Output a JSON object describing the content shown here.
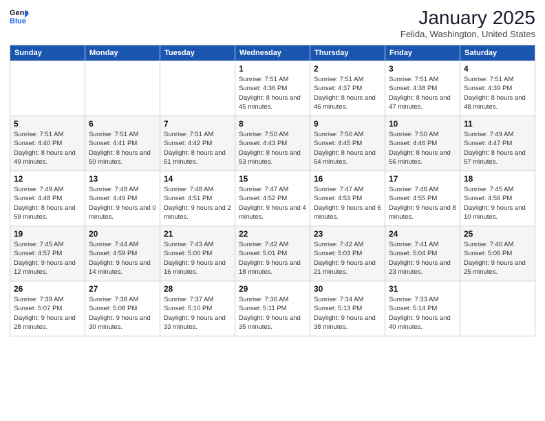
{
  "header": {
    "logo_general": "General",
    "logo_blue": "Blue",
    "month_title": "January 2025",
    "subtitle": "Felida, Washington, United States"
  },
  "weekdays": [
    "Sunday",
    "Monday",
    "Tuesday",
    "Wednesday",
    "Thursday",
    "Friday",
    "Saturday"
  ],
  "weeks": [
    [
      {
        "day": "",
        "sunrise": "",
        "sunset": "",
        "daylight": ""
      },
      {
        "day": "",
        "sunrise": "",
        "sunset": "",
        "daylight": ""
      },
      {
        "day": "",
        "sunrise": "",
        "sunset": "",
        "daylight": ""
      },
      {
        "day": "1",
        "sunrise": "Sunrise: 7:51 AM",
        "sunset": "Sunset: 4:36 PM",
        "daylight": "Daylight: 8 hours and 45 minutes."
      },
      {
        "day": "2",
        "sunrise": "Sunrise: 7:51 AM",
        "sunset": "Sunset: 4:37 PM",
        "daylight": "Daylight: 8 hours and 46 minutes."
      },
      {
        "day": "3",
        "sunrise": "Sunrise: 7:51 AM",
        "sunset": "Sunset: 4:38 PM",
        "daylight": "Daylight: 8 hours and 47 minutes."
      },
      {
        "day": "4",
        "sunrise": "Sunrise: 7:51 AM",
        "sunset": "Sunset: 4:39 PM",
        "daylight": "Daylight: 8 hours and 48 minutes."
      }
    ],
    [
      {
        "day": "5",
        "sunrise": "Sunrise: 7:51 AM",
        "sunset": "Sunset: 4:40 PM",
        "daylight": "Daylight: 8 hours and 49 minutes."
      },
      {
        "day": "6",
        "sunrise": "Sunrise: 7:51 AM",
        "sunset": "Sunset: 4:41 PM",
        "daylight": "Daylight: 8 hours and 50 minutes."
      },
      {
        "day": "7",
        "sunrise": "Sunrise: 7:51 AM",
        "sunset": "Sunset: 4:42 PM",
        "daylight": "Daylight: 8 hours and 51 minutes."
      },
      {
        "day": "8",
        "sunrise": "Sunrise: 7:50 AM",
        "sunset": "Sunset: 4:43 PM",
        "daylight": "Daylight: 8 hours and 53 minutes."
      },
      {
        "day": "9",
        "sunrise": "Sunrise: 7:50 AM",
        "sunset": "Sunset: 4:45 PM",
        "daylight": "Daylight: 8 hours and 54 minutes."
      },
      {
        "day": "10",
        "sunrise": "Sunrise: 7:50 AM",
        "sunset": "Sunset: 4:46 PM",
        "daylight": "Daylight: 8 hours and 56 minutes."
      },
      {
        "day": "11",
        "sunrise": "Sunrise: 7:49 AM",
        "sunset": "Sunset: 4:47 PM",
        "daylight": "Daylight: 8 hours and 57 minutes."
      }
    ],
    [
      {
        "day": "12",
        "sunrise": "Sunrise: 7:49 AM",
        "sunset": "Sunset: 4:48 PM",
        "daylight": "Daylight: 8 hours and 59 minutes."
      },
      {
        "day": "13",
        "sunrise": "Sunrise: 7:48 AM",
        "sunset": "Sunset: 4:49 PM",
        "daylight": "Daylight: 9 hours and 0 minutes."
      },
      {
        "day": "14",
        "sunrise": "Sunrise: 7:48 AM",
        "sunset": "Sunset: 4:51 PM",
        "daylight": "Daylight: 9 hours and 2 minutes."
      },
      {
        "day": "15",
        "sunrise": "Sunrise: 7:47 AM",
        "sunset": "Sunset: 4:52 PM",
        "daylight": "Daylight: 9 hours and 4 minutes."
      },
      {
        "day": "16",
        "sunrise": "Sunrise: 7:47 AM",
        "sunset": "Sunset: 4:53 PM",
        "daylight": "Daylight: 9 hours and 6 minutes."
      },
      {
        "day": "17",
        "sunrise": "Sunrise: 7:46 AM",
        "sunset": "Sunset: 4:55 PM",
        "daylight": "Daylight: 9 hours and 8 minutes."
      },
      {
        "day": "18",
        "sunrise": "Sunrise: 7:45 AM",
        "sunset": "Sunset: 4:56 PM",
        "daylight": "Daylight: 9 hours and 10 minutes."
      }
    ],
    [
      {
        "day": "19",
        "sunrise": "Sunrise: 7:45 AM",
        "sunset": "Sunset: 4:57 PM",
        "daylight": "Daylight: 9 hours and 12 minutes."
      },
      {
        "day": "20",
        "sunrise": "Sunrise: 7:44 AM",
        "sunset": "Sunset: 4:59 PM",
        "daylight": "Daylight: 9 hours and 14 minutes."
      },
      {
        "day": "21",
        "sunrise": "Sunrise: 7:43 AM",
        "sunset": "Sunset: 5:00 PM",
        "daylight": "Daylight: 9 hours and 16 minutes."
      },
      {
        "day": "22",
        "sunrise": "Sunrise: 7:42 AM",
        "sunset": "Sunset: 5:01 PM",
        "daylight": "Daylight: 9 hours and 18 minutes."
      },
      {
        "day": "23",
        "sunrise": "Sunrise: 7:42 AM",
        "sunset": "Sunset: 5:03 PM",
        "daylight": "Daylight: 9 hours and 21 minutes."
      },
      {
        "day": "24",
        "sunrise": "Sunrise: 7:41 AM",
        "sunset": "Sunset: 5:04 PM",
        "daylight": "Daylight: 9 hours and 23 minutes."
      },
      {
        "day": "25",
        "sunrise": "Sunrise: 7:40 AM",
        "sunset": "Sunset: 5:06 PM",
        "daylight": "Daylight: 9 hours and 25 minutes."
      }
    ],
    [
      {
        "day": "26",
        "sunrise": "Sunrise: 7:39 AM",
        "sunset": "Sunset: 5:07 PM",
        "daylight": "Daylight: 9 hours and 28 minutes."
      },
      {
        "day": "27",
        "sunrise": "Sunrise: 7:38 AM",
        "sunset": "Sunset: 5:08 PM",
        "daylight": "Daylight: 9 hours and 30 minutes."
      },
      {
        "day": "28",
        "sunrise": "Sunrise: 7:37 AM",
        "sunset": "Sunset: 5:10 PM",
        "daylight": "Daylight: 9 hours and 33 minutes."
      },
      {
        "day": "29",
        "sunrise": "Sunrise: 7:36 AM",
        "sunset": "Sunset: 5:11 PM",
        "daylight": "Daylight: 9 hours and 35 minutes."
      },
      {
        "day": "30",
        "sunrise": "Sunrise: 7:34 AM",
        "sunset": "Sunset: 5:13 PM",
        "daylight": "Daylight: 9 hours and 38 minutes."
      },
      {
        "day": "31",
        "sunrise": "Sunrise: 7:33 AM",
        "sunset": "Sunset: 5:14 PM",
        "daylight": "Daylight: 9 hours and 40 minutes."
      },
      {
        "day": "",
        "sunrise": "",
        "sunset": "",
        "daylight": ""
      }
    ]
  ]
}
